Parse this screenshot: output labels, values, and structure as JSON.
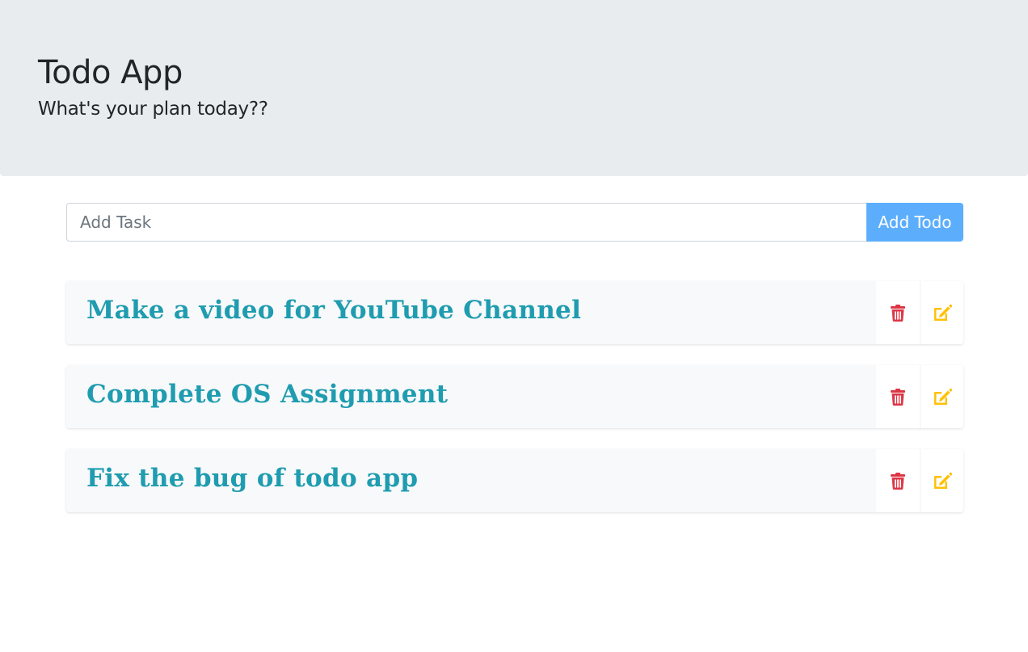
{
  "header": {
    "title": "Todo App",
    "subtitle": "What's your plan today??"
  },
  "form": {
    "input_placeholder": "Add Task",
    "input_value": "",
    "add_button_label": "Add Todo"
  },
  "todos": [
    {
      "text": "Make a video for YouTube Channel",
      "delete_icon": "trash-icon",
      "edit_icon": "edit-icon"
    },
    {
      "text": "Complete OS Assignment",
      "delete_icon": "trash-icon",
      "edit_icon": "edit-icon"
    },
    {
      "text": "Fix the bug of todo app",
      "delete_icon": "trash-icon",
      "edit_icon": "edit-icon"
    }
  ],
  "colors": {
    "header_bg": "#e9ecef",
    "add_button_bg": "#5caefc",
    "todo_text": "#1f9cb0",
    "delete_icon": "#dc3545",
    "edit_icon": "#ffc107"
  }
}
